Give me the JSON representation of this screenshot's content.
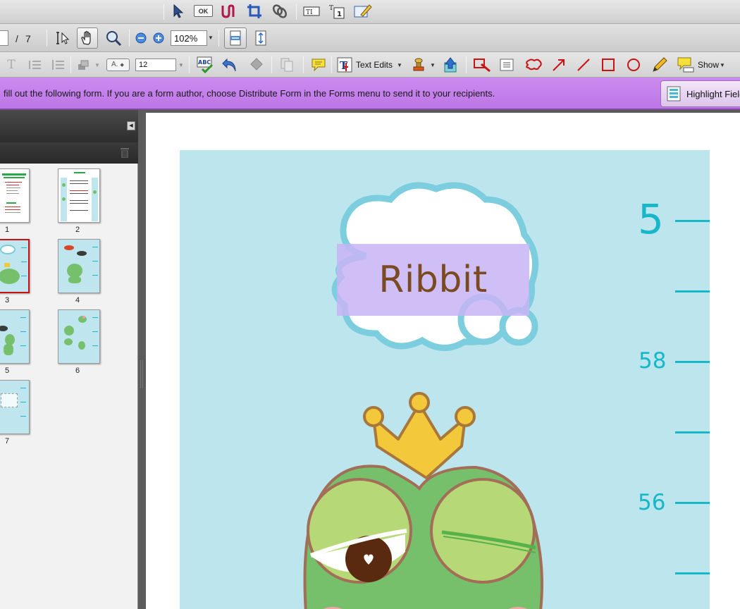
{
  "toolbar2": {
    "page_separator": "/",
    "page_total": "7",
    "zoom": "102%"
  },
  "toolbar3": {
    "font_size": "12",
    "font_style": "A.",
    "text_edits_label": "Text Edits",
    "show_label": "Show"
  },
  "formbar": {
    "message": "fill out the following form. If you are a form author, choose Distribute Form in the Forms menu to send it to your recipients.",
    "highlight_label": "Highlight Fields"
  },
  "thumbnails": [
    "1",
    "2",
    "3",
    "4",
    "5",
    "6",
    "7"
  ],
  "document": {
    "bubble_text": "Ribbit",
    "scale_labels": [
      "5",
      "58",
      "56"
    ]
  },
  "colors": {
    "form_bar": "#c47fea",
    "chart_background": "#bde5ee",
    "scale_teal": "#17b7c7",
    "frog_green": "#76c06b",
    "crown_yellow": "#f3c83a"
  }
}
